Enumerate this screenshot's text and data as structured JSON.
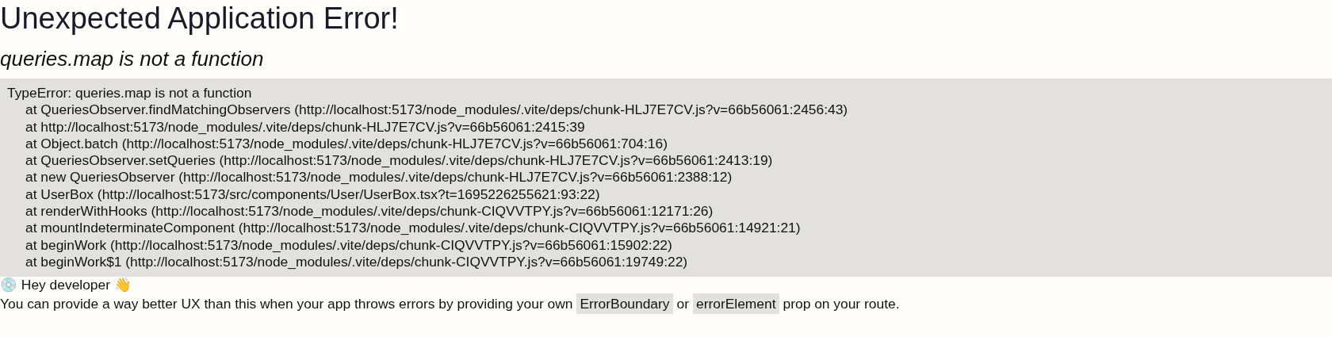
{
  "title": "Unexpected Application Error!",
  "message": "queries.map is not a function",
  "stack": {
    "error": "TypeError: queries.map is not a function",
    "frames": [
      "at QueriesObserver.findMatchingObservers (http://localhost:5173/node_modules/.vite/deps/chunk-HLJ7E7CV.js?v=66b56061:2456:43)",
      "at http://localhost:5173/node_modules/.vite/deps/chunk-HLJ7E7CV.js?v=66b56061:2415:39",
      "at Object.batch (http://localhost:5173/node_modules/.vite/deps/chunk-HLJ7E7CV.js?v=66b56061:704:16)",
      "at QueriesObserver.setQueries (http://localhost:5173/node_modules/.vite/deps/chunk-HLJ7E7CV.js?v=66b56061:2413:19)",
      "at new QueriesObserver (http://localhost:5173/node_modules/.vite/deps/chunk-HLJ7E7CV.js?v=66b56061:2388:12)",
      "at UserBox (http://localhost:5173/src/components/User/UserBox.tsx?t=1695226255621:93:22)",
      "at renderWithHooks (http://localhost:5173/node_modules/.vite/deps/chunk-CIQVVTPY.js?v=66b56061:12171:26)",
      "at mountIndeterminateComponent (http://localhost:5173/node_modules/.vite/deps/chunk-CIQVVTPY.js?v=66b56061:14921:21)",
      "at beginWork (http://localhost:5173/node_modules/.vite/deps/chunk-CIQVVTPY.js?v=66b56061:15902:22)",
      "at beginWork$1 (http://localhost:5173/node_modules/.vite/deps/chunk-CIQVVTPY.js?v=66b56061:19749:22)"
    ]
  },
  "greeting": "💿 Hey developer 👋",
  "hint": [
    {
      "kind": "text",
      "text": "You can provide a way better UX than this when your app throws errors by providing your own"
    },
    {
      "kind": "code",
      "text": "ErrorBoundary"
    },
    {
      "kind": "text",
      "text": "or"
    },
    {
      "kind": "code",
      "text": "errorElement"
    },
    {
      "kind": "text",
      "text": "prop on your route."
    }
  ]
}
